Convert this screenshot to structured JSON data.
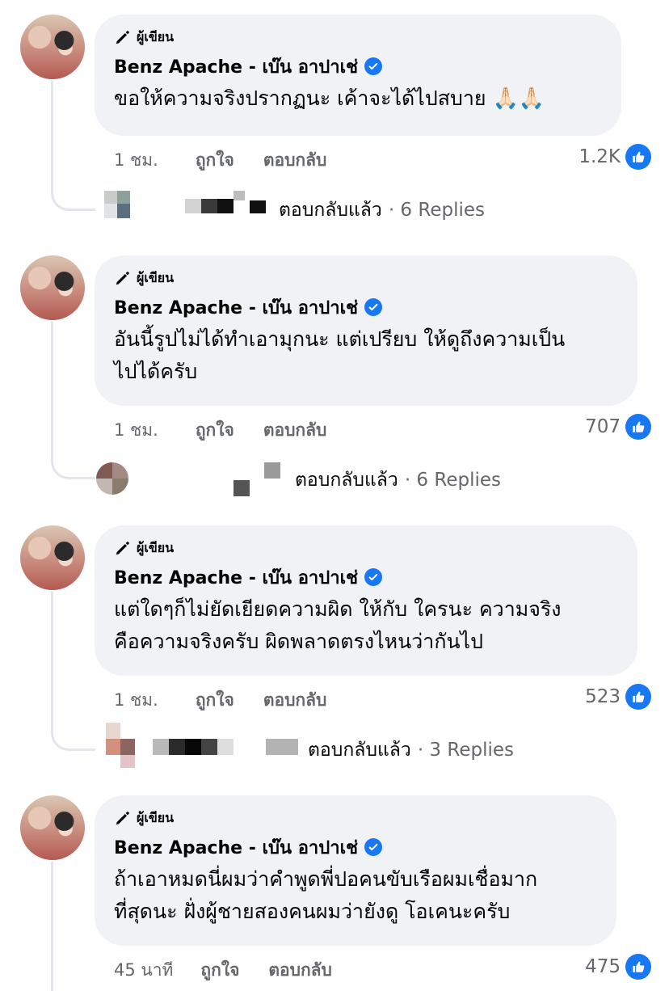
{
  "author_label": "ผู้เขียน",
  "comments": [
    {
      "name": "Benz Apache - เบ๊น อาปาเช่",
      "text": "ขอให้ความจริงปรากฏนะ เค้าจะได้ไปสบาย",
      "emoji": "🙏🏻🙏🏻",
      "time": "1 ชม.",
      "like": "ถูกใจ",
      "reply": "ตอบกลับ",
      "reactions": "1.2K",
      "replied_label": "ตอบกลับแล้ว",
      "replies": "· 6 Replies"
    },
    {
      "name": "Benz Apache - เบ๊น อาปาเช่",
      "text": "อันนี้รูปไม่ได้ทำเอามุกนะ แต่เปรียบ ให้ดูถึงความเป็น\nไปได้ครับ",
      "time": "1 ชม.",
      "like": "ถูกใจ",
      "reply": "ตอบกลับ",
      "reactions": "707",
      "replied_label": "ตอบกลับแล้ว",
      "replies": "· 6 Replies"
    },
    {
      "name": "Benz Apache - เบ๊น อาปาเช่",
      "text": "แต่ใดๆก็ไม่ยัดเยียดความผิด ให้กับ ใครนะ ความจริง\nคือความจริงครับ ผิดพลาดตรงไหนว่ากันไป",
      "time": "1 ชม.",
      "like": "ถูกใจ",
      "reply": "ตอบกลับ",
      "reactions": "523",
      "replied_label": "ตอบกลับแล้ว",
      "replies": "· 3 Replies"
    },
    {
      "name": "Benz Apache - เบ๊น อาปาเช่",
      "text": "ถ้าเอาหมดนี่ผมว่าคำพูดพี่ปอคนขับเรือผมเชื่อมาก\nที่สุดนะ ฝั่งผู้ชายสองคนผมว่ายังดู โอเคนะครับ",
      "time": "45 นาที",
      "like": "ถูกใจ",
      "reply": "ตอบกลับ",
      "reactions": "475"
    }
  ],
  "colors": {
    "bubble": "#f0f2f5",
    "accent": "#1877f2",
    "meta": "#65676b"
  },
  "icons": {
    "author": "pen-icon",
    "verified": "verified-check-icon",
    "like": "thumbs-up-icon"
  }
}
